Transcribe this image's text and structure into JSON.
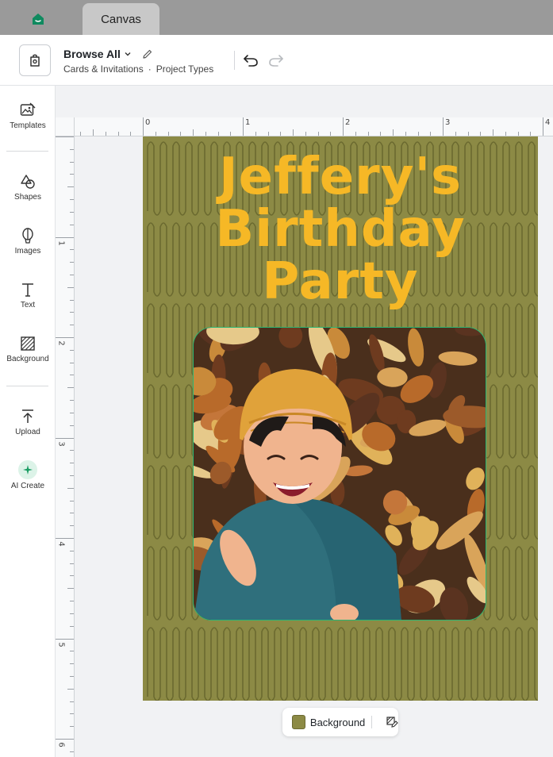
{
  "tabs": {
    "home_icon": "home-icon",
    "active_tab": "Canvas"
  },
  "header": {
    "browse_label": "Browse All",
    "breadcrumb": [
      "Cards & Invitations",
      "Project Types"
    ],
    "breadcrumb_separator": "·"
  },
  "sidebar": {
    "items": [
      {
        "label": "Templates",
        "icon": "templates-icon"
      },
      {
        "label": "Shapes",
        "icon": "shapes-icon"
      },
      {
        "label": "Images",
        "icon": "images-icon"
      },
      {
        "label": "Text",
        "icon": "text-icon"
      },
      {
        "label": "Background",
        "icon": "background-icon"
      },
      {
        "label": "Upload",
        "icon": "upload-icon"
      },
      {
        "label": "AI Create",
        "icon": "ai-sparkle-icon"
      }
    ]
  },
  "rulers": {
    "top_numbers": [
      "0",
      "1",
      "2",
      "3",
      "4"
    ],
    "left_numbers": [
      "1",
      "2",
      "3",
      "4",
      "5",
      "6"
    ]
  },
  "card": {
    "title_lines": [
      "Jeffery's",
      "Birthday",
      "Party"
    ],
    "background_color": "#8c8a45",
    "title_color": "#f6b826",
    "selection_color": "#2bb673"
  },
  "background_pill": {
    "label": "Background"
  },
  "colors": {
    "accent_green": "#0f8a5f",
    "tabbar": "#9a9a9a"
  }
}
